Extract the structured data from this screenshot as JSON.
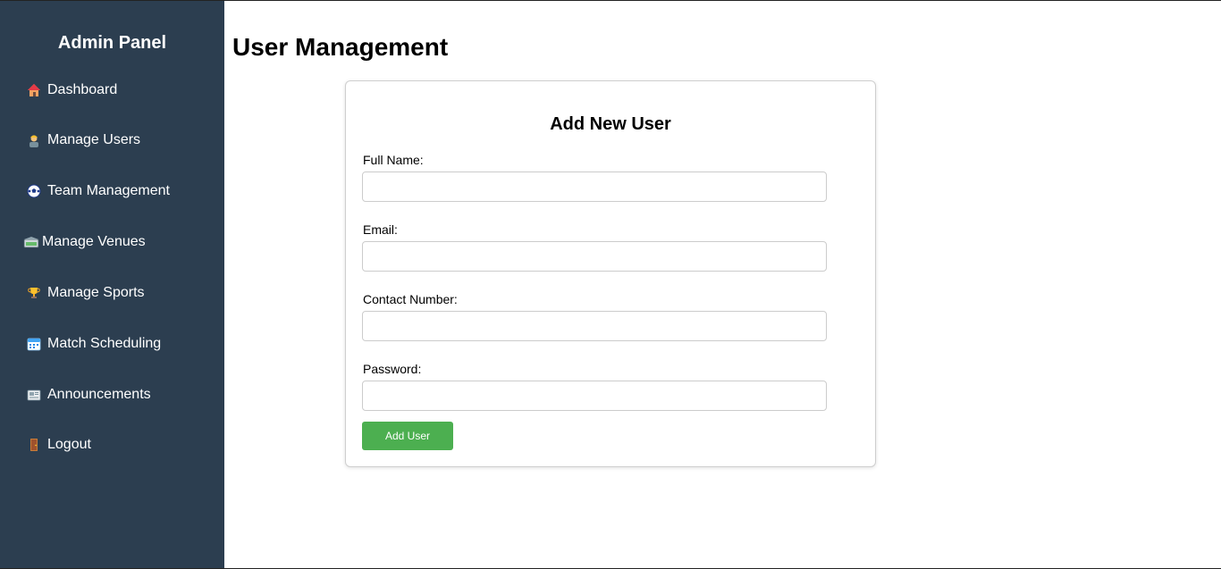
{
  "sidebar": {
    "title": "Admin Panel",
    "items": [
      {
        "label": "Dashboard",
        "icon": "house-icon"
      },
      {
        "label": "Manage Users",
        "icon": "user-worker-icon"
      },
      {
        "label": "Team Management",
        "icon": "soccer-ball-icon"
      },
      {
        "label": "Manage Venues",
        "icon": "stadium-icon"
      },
      {
        "label": "Manage Sports",
        "icon": "trophy-icon"
      },
      {
        "label": "Match Scheduling",
        "icon": "calendar-icon"
      },
      {
        "label": "Announcements",
        "icon": "newspaper-icon"
      },
      {
        "label": "Logout",
        "icon": "door-icon"
      }
    ]
  },
  "main": {
    "title": "User Management"
  },
  "form": {
    "title": "Add New User",
    "fields": [
      {
        "label": "Full Name:",
        "value": "",
        "placeholder": ""
      },
      {
        "label": "Email:",
        "value": "",
        "placeholder": ""
      },
      {
        "label": "Contact Number:",
        "value": "",
        "placeholder": ""
      },
      {
        "label": "Password:",
        "value": "",
        "placeholder": ""
      }
    ],
    "submit_label": "Add User"
  },
  "colors": {
    "sidebar_bg": "#2c3e50",
    "button_bg": "#4caf50"
  }
}
